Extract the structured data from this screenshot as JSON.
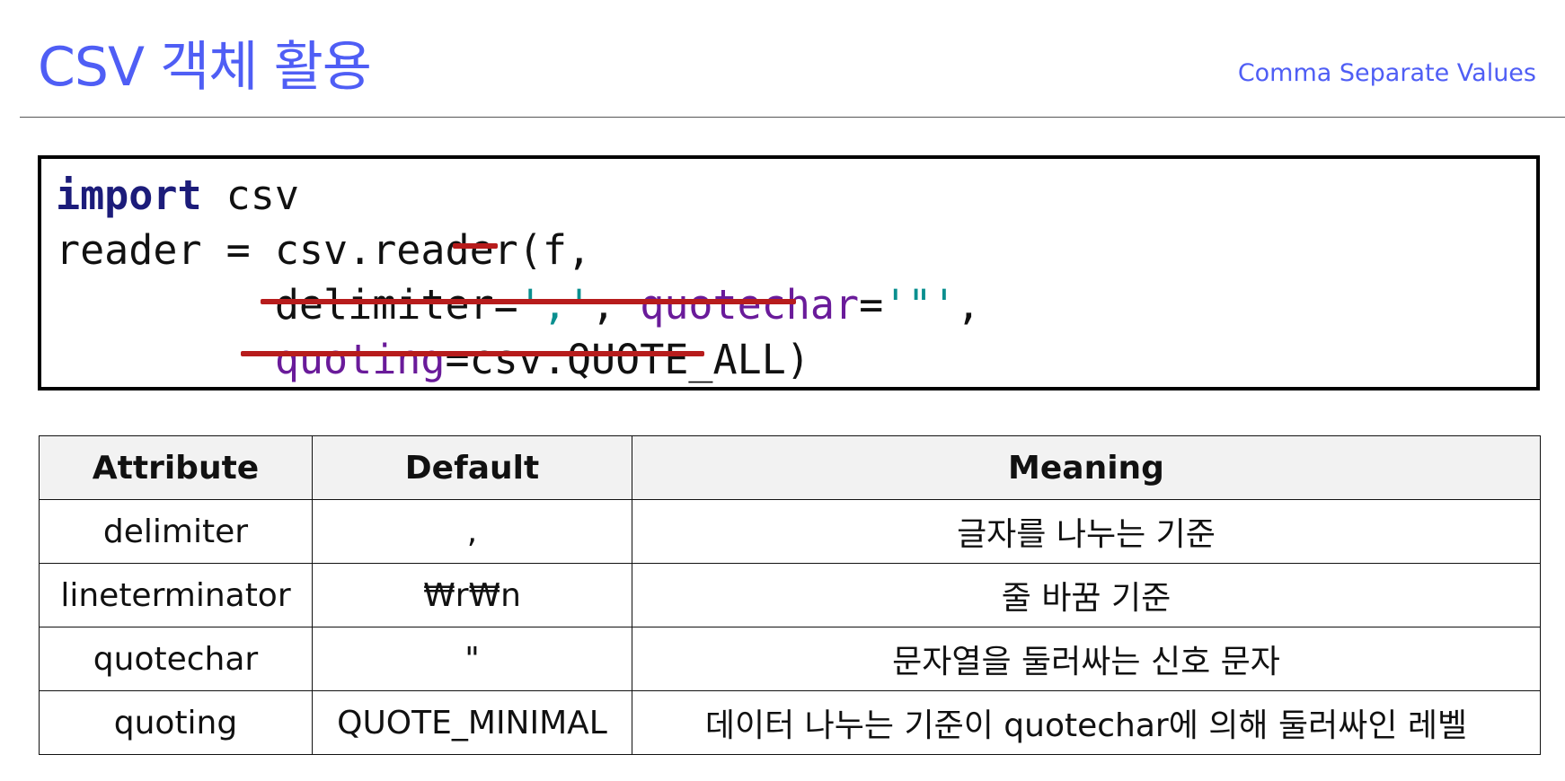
{
  "header": {
    "title": "CSV 객체 활용",
    "subtitle": "Comma Separate Values"
  },
  "code": {
    "line1": {
      "keyword": "import",
      "module": " csv"
    },
    "line2": {
      "text": "reader = csv.reader(f,"
    },
    "line3": {
      "indent": "         ",
      "param1": "delimiter=",
      "value1": "','",
      "sep": ", ",
      "param2": "quotechar",
      "eq": "=",
      "value2": "'\"'",
      "end": ","
    },
    "line4": {
      "indent": "         ",
      "param": "quoting",
      "rest": "=csv.QUOTE_ALL)"
    }
  },
  "table": {
    "headers": [
      "Attribute",
      "Default",
      "Meaning"
    ],
    "rows": [
      [
        "delimiter",
        ",",
        "글자를 나누는 기준"
      ],
      [
        "lineterminator",
        "₩r₩n",
        "줄 바꿈 기준"
      ],
      [
        "quotechar",
        "\"",
        "문자열을 둘러싸는 신호 문자"
      ],
      [
        "quoting",
        "QUOTE_MINIMAL",
        "데이터 나누는 기준이 quotechar에 의해 둘러싸인 레벨"
      ]
    ]
  },
  "colors": {
    "title": "#4f5ef5",
    "keyword": "#1c1c7a",
    "parameter": "#6a1b9a",
    "string": "#0a8f8f",
    "underline": "#b71c1c"
  }
}
